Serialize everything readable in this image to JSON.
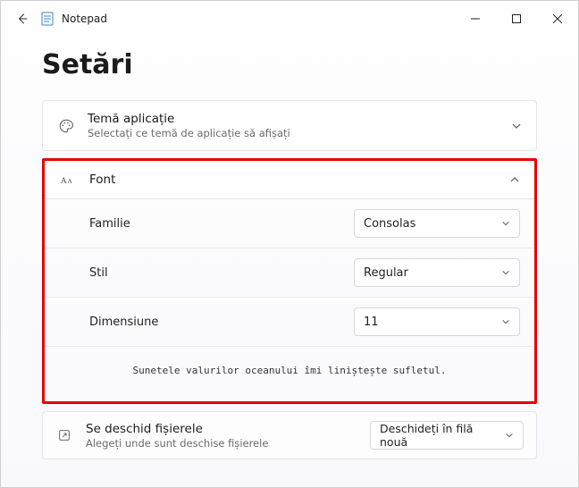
{
  "window": {
    "app_title": "Notepad"
  },
  "page": {
    "heading": "Setări"
  },
  "theme": {
    "title": "Temă aplicație",
    "subtitle": "Selectați ce temă de aplicație să afișați"
  },
  "font": {
    "title": "Font",
    "family_label": "Familie",
    "family_value": "Consolas",
    "style_label": "Stil",
    "style_value": "Regular",
    "size_label": "Dimensiune",
    "size_value": "11",
    "preview": "Sunetele valurilor oceanului îmi liniștește sufletul."
  },
  "files": {
    "title": "Se deschid fișierele",
    "subtitle": "Alegeți unde sunt deschise fișierele",
    "value": "Deschideți în filă nouă"
  },
  "colors": {
    "highlight": "#e70000"
  }
}
